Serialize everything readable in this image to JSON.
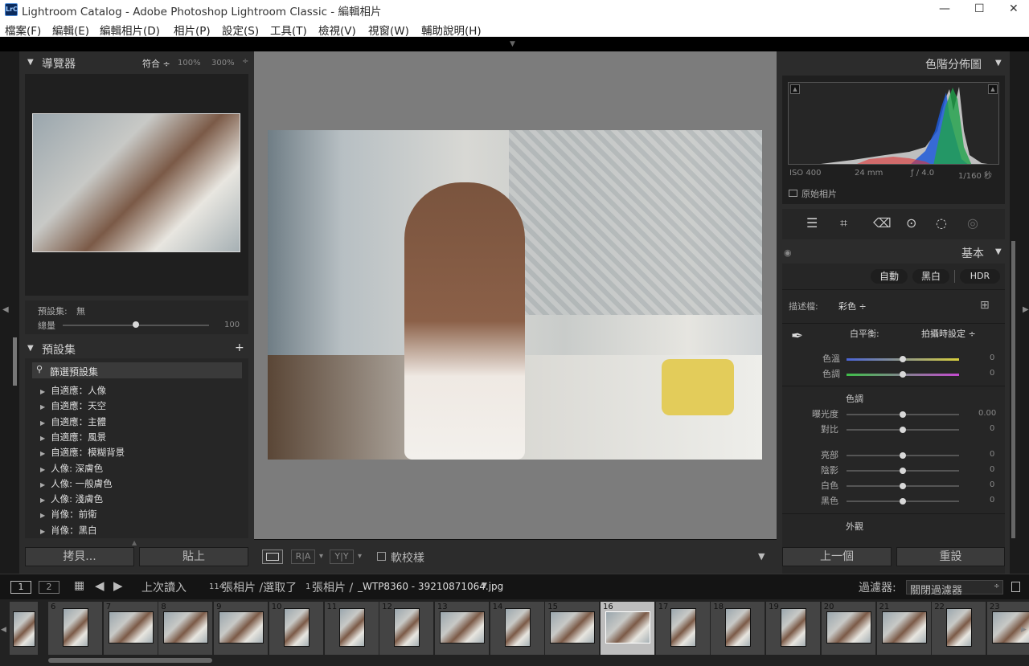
{
  "window": {
    "title": "Lightroom Catalog - Adobe Photoshop Lightroom Classic - 編輯相片",
    "logo": "LrC"
  },
  "menu": [
    "檔案(F)",
    "編輯(E)",
    "編輯相片(D)",
    "相片(P)",
    "設定(S)",
    "工具(T)",
    "檢視(V)",
    "視窗(W)",
    "輔助說明(H)"
  ],
  "navigator": {
    "title": "導覽器",
    "fit": "符合 ÷",
    "zoom1": "100%",
    "zoom2": "300%"
  },
  "preset_amount": {
    "label": "預設集:",
    "value": "無",
    "amount_label": "總量",
    "amount_value": "100",
    "amount_level": 0.5
  },
  "presets": {
    "title": "預設集",
    "filter": "篩選預設集",
    "items": [
      "自適應：人像",
      "自適應：天空",
      "自適應：主體",
      "自適應：風景",
      "自適應：模糊背景",
      "人像: 深膚色",
      "人像: 一般膚色",
      "人像: 淺膚色",
      "肖像：前衛",
      "肖像：黑白"
    ]
  },
  "left_buttons": {
    "copy": "拷貝...",
    "paste": "貼上"
  },
  "toolbar": {
    "softproof": "軟校樣",
    "ra": "R|A",
    "yy": "Y|Y"
  },
  "histogram": {
    "title": "色階分佈圖",
    "iso": "ISO 400",
    "focal": "24 mm",
    "aperture": "ƒ / 4.0",
    "shutter": "1/160 秒",
    "original": "原始相片"
  },
  "basic": {
    "title": "基本",
    "auto": "自動",
    "bw": "黑白",
    "hdr": "HDR",
    "profile_label": "描述檔:",
    "profile_value": "彩色 ÷",
    "wb_label": "白平衡:",
    "wb_value": "拍攝時設定 ÷",
    "temp": {
      "label": "色溫",
      "value": "0",
      "level": 0.5
    },
    "tint": {
      "label": "色調",
      "value": "0",
      "level": 0.5
    },
    "tone_title": "色調",
    "exposure": {
      "label": "曝光度",
      "value": "0.00",
      "level": 0.5
    },
    "contrast": {
      "label": "對比",
      "value": "0",
      "level": 0.5
    },
    "highlights": {
      "label": "亮部",
      "value": "0",
      "level": 0.5
    },
    "shadows": {
      "label": "陰影",
      "value": "0",
      "level": 0.5
    },
    "whites": {
      "label": "白色",
      "value": "0",
      "level": 0.5
    },
    "blacks": {
      "label": "黑色",
      "value": "0",
      "level": 0.5
    },
    "presence_title": "外觀"
  },
  "right_buttons": {
    "prev": "上一個",
    "reset": "重設"
  },
  "filmbar": {
    "view1": "1",
    "view2": "2",
    "source": "上次讀入",
    "count_a": "114",
    "count_b": "張相片 /選取了",
    "count_c": "1",
    "count_d": "張相片 /",
    "filename": "_WTP8360 - 39210871064.jpg",
    "filter_label": "過濾器:",
    "filter_value": "關閉過濾器"
  },
  "film_numbers": [
    "6",
    "7",
    "8",
    "9",
    "10",
    "11",
    "12",
    "13",
    "14",
    "15",
    "16",
    "17",
    "18",
    "19",
    "20",
    "21",
    "22",
    "23"
  ],
  "colors": {
    "accent": "#ffffff",
    "panel": "#2c2c2c",
    "center_bg": "#7c7c7c"
  }
}
